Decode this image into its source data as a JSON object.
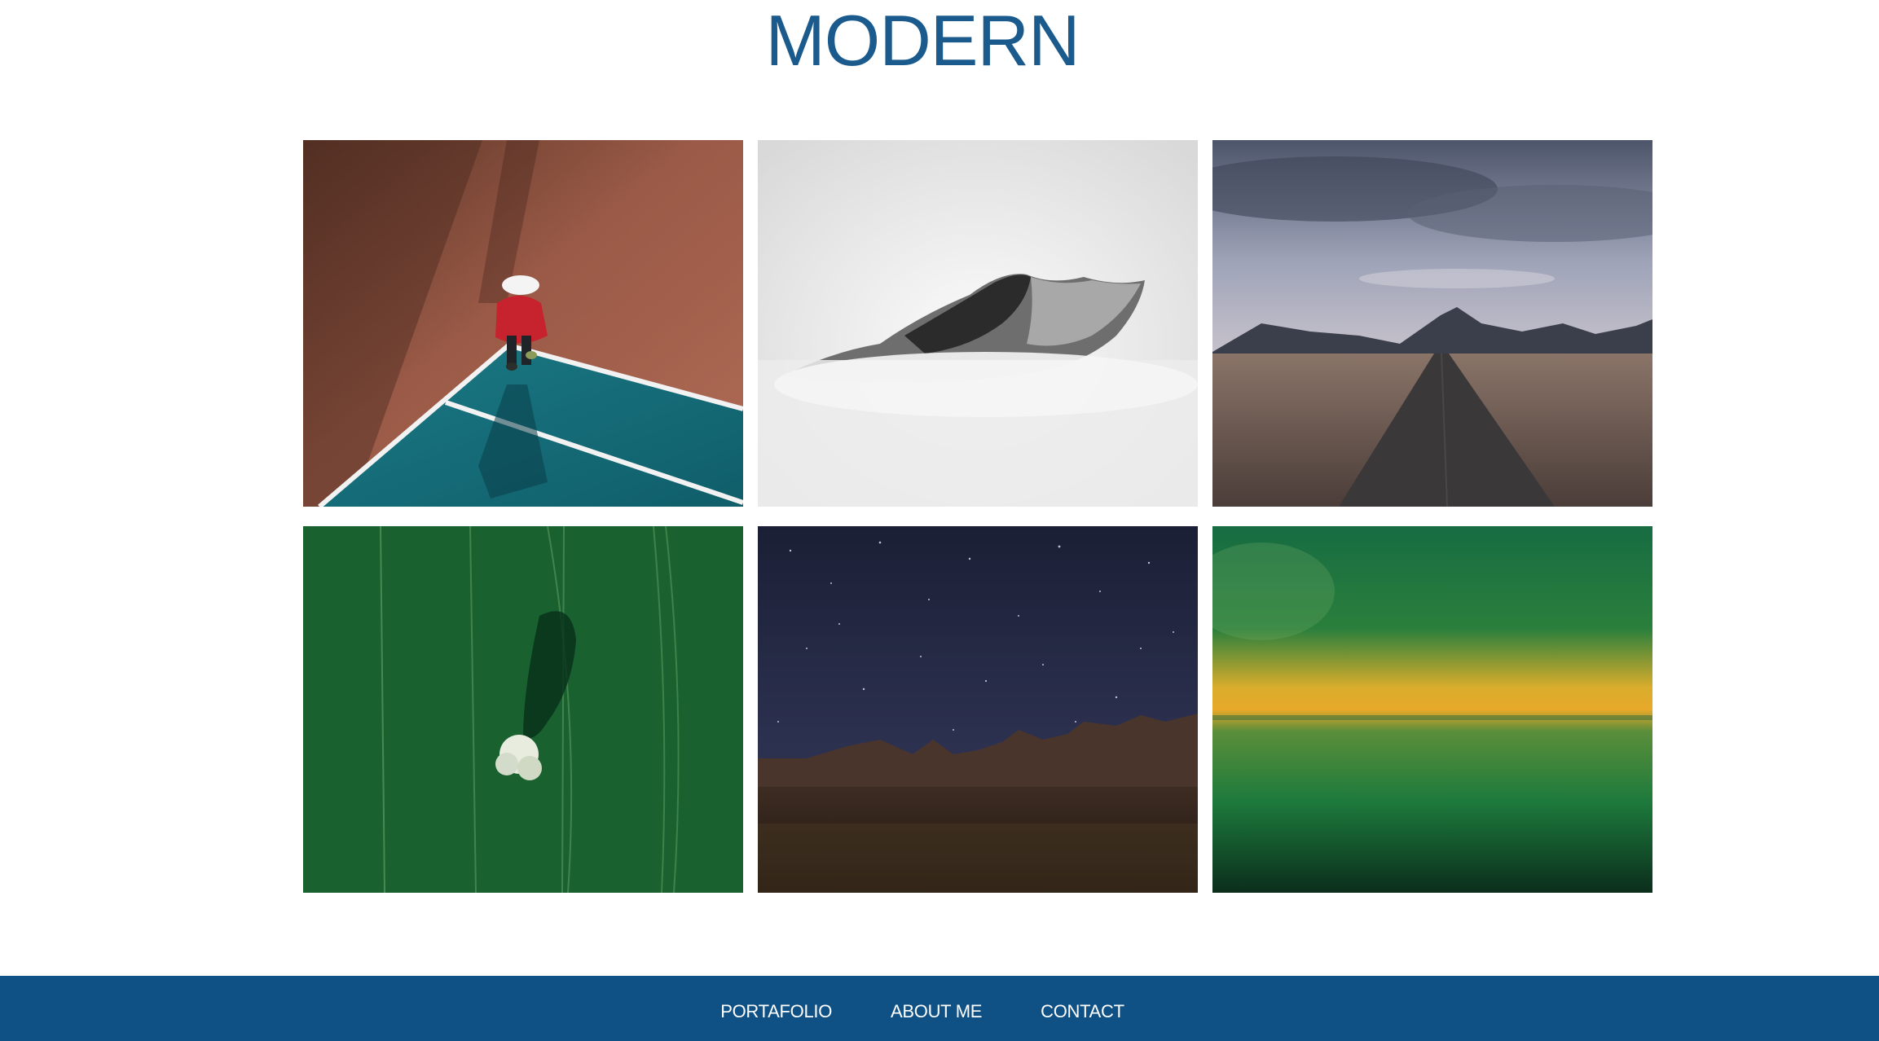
{
  "site": {
    "title": "MODERN"
  },
  "gallery": {
    "images": [
      {
        "alt": "person-on-tennis-court",
        "icon": "photo-icon"
      },
      {
        "alt": "misty-mountain-peak",
        "icon": "photo-icon"
      },
      {
        "alt": "road-to-mountains",
        "icon": "photo-icon"
      },
      {
        "alt": "tree-in-green-field",
        "icon": "photo-icon"
      },
      {
        "alt": "starry-night-mountains",
        "icon": "photo-icon"
      },
      {
        "alt": "green-yellow-sunset-water",
        "icon": "photo-icon"
      }
    ]
  },
  "footer": {
    "nav": [
      {
        "label": "PORTAFOLIO"
      },
      {
        "label": "ABOUT ME"
      },
      {
        "label": "CONTACT"
      }
    ]
  },
  "colors": {
    "title": "#1a5a8c",
    "footer_bg": "#0f5185",
    "footer_text": "#ffffff",
    "page_bg": "#ffffff"
  }
}
